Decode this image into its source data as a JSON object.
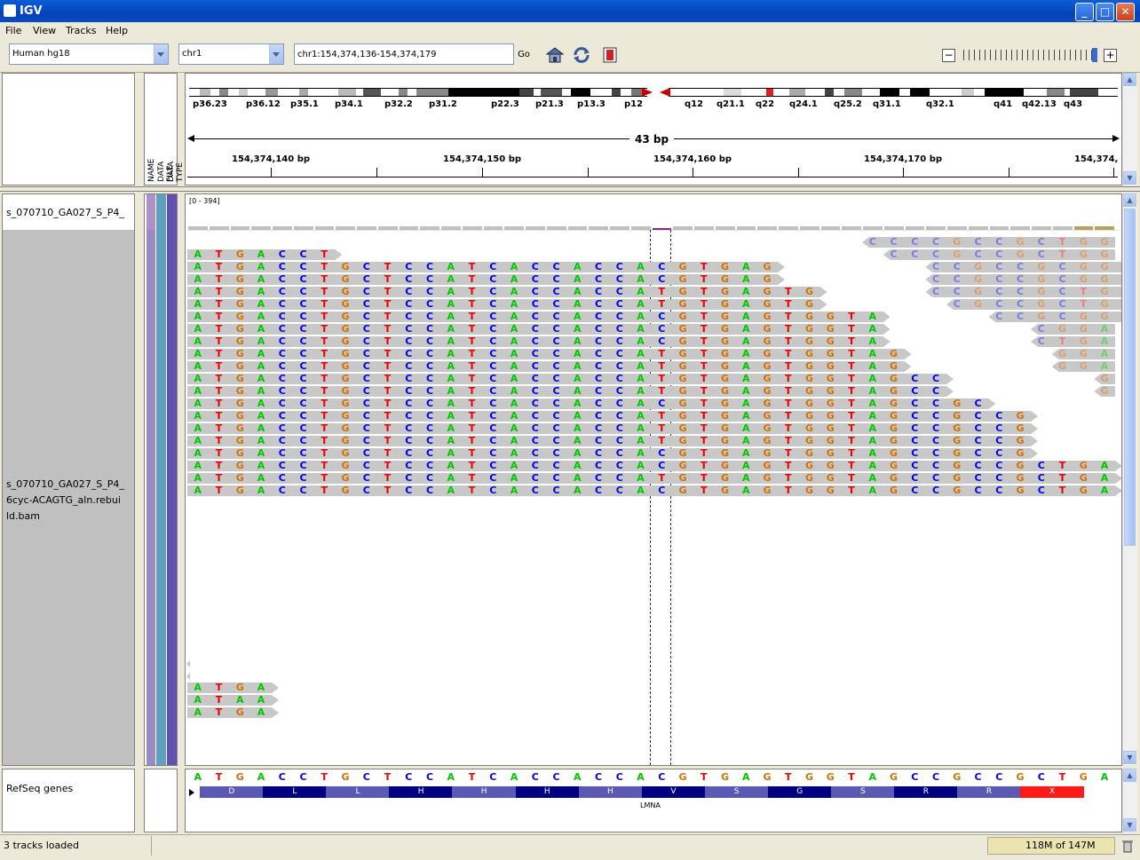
{
  "window": {
    "title": "IGV"
  },
  "menu": [
    "File",
    "View",
    "Tracks",
    "Help"
  ],
  "toolbar": {
    "genome": "Human hg18",
    "chromosome": "chr1",
    "locus": "chr1:154,374,136-154,374,179",
    "go_label": "Go",
    "icons": [
      "home-icon",
      "refresh-icon",
      "region-icon"
    ],
    "zoom_minus": "−",
    "zoom_plus": "+"
  },
  "ideogram": {
    "bands": [
      "p36.23",
      "p36.12",
      "p35.1",
      "p34.1",
      "p32.2",
      "p31.2",
      "p22.3",
      "p21.3",
      "p13.3",
      "p12",
      "q12",
      "q21.1",
      "q22",
      "q24.1",
      "q25.2",
      "q31.1",
      "q32.1",
      "q41",
      "q42.13",
      "q43"
    ],
    "span_label": "43 bp",
    "ruler": [
      "154,374,140 bp",
      "154,374,150 bp",
      "154,374,160 bp",
      "154,374,170 bp",
      "154,374,"
    ]
  },
  "attribute_headers": [
    "NAME",
    "DATA FILE",
    "DATA TYPE"
  ],
  "tracks": {
    "coverage_name": "s_070710_GA027_S_P4_",
    "alignment_name": "s_070710_GA027_S_P4_6cyc-ACAGTG_aln.rebuild.bam",
    "alignment_name_lines": [
      "s_070710_GA027_S_P4_",
      "6cyc-ACAGTG_aln.rebui",
      "ld.bam"
    ],
    "coverage_range": "[0 - 394]",
    "refseq_name": "RefSeq genes",
    "gene_name": "LMNA"
  },
  "reference_sequence": "ATGACCTGCTCCATCACCACCACGTGAGTGGTAGCCGCCGCTGA",
  "amino_acids": [
    "D",
    "L",
    "L",
    "H",
    "H",
    "H",
    "H",
    "V",
    "S",
    "G",
    "S",
    "R",
    "R",
    "X"
  ],
  "reads": [
    {
      "start": 32,
      "seq": "CCCCGCCGCTGG",
      "dim": true
    },
    {
      "start": 33,
      "seq": "CCCGCCGCTGG",
      "dim": true
    },
    {
      "start": 0,
      "seq": "ATGACCT"
    },
    {
      "start": 35,
      "seq": "CCGCCGCGGG",
      "dim": true
    },
    {
      "start": 0,
      "seq": "ATGACCTGCTCCATCACCACCACGTGAG"
    },
    {
      "start": 35,
      "seq": "CCGCCGCGGG",
      "dim": true
    },
    {
      "start": 0,
      "seq": "ATGACCTGCTCCATCACCACCACGTGAG"
    },
    {
      "start": 35,
      "seq": "CCGCCGCTGG",
      "dim": true
    },
    {
      "start": 0,
      "seq": "ATGACCTGCTCCATCACCACCATGTGAGTG"
    },
    {
      "start": 36,
      "seq": "CGCCGCTGG",
      "dim": true
    },
    {
      "start": 0,
      "seq": "ATGACCTGCTCCATCACCACCATGTGAGTG"
    },
    {
      "start": 38,
      "seq": "CCGCGGA",
      "dim": true
    },
    {
      "start": 0,
      "seq": "ATGACCTGCTCCATCACCACCACGTGAGTGGTA"
    },
    {
      "start": 40,
      "seq": "CGGA",
      "dim": true
    },
    {
      "start": 0,
      "seq": "ATGACCTGCTCCATCACCACCACGTGAGTGGTA"
    },
    {
      "start": 40,
      "seq": "CTGA",
      "dim": true
    },
    {
      "start": 0,
      "seq": "ATGACCTGCTCCATCACCACCACGTGAGTGGTA"
    },
    {
      "start": 41,
      "seq": "GGA",
      "dim": true
    },
    {
      "start": 0,
      "seq": "ATGACCTGCTCCATCACCACCATGTGAGTGGTAG"
    },
    {
      "start": 41,
      "seq": "GGA",
      "dim": true
    },
    {
      "start": 0,
      "seq": "ATGACCTGCTCCATCACCACCATGTGAGTGGTAG"
    },
    {
      "start": 43,
      "seq": "G",
      "dim": true
    },
    {
      "start": 0,
      "seq": "ATGACCTGCTCCATCACCACCATGTGAGTGGTAGCC"
    },
    {
      "start": 43,
      "seq": "G",
      "dim": true
    },
    {
      "start": 0,
      "seq": "ATGACCTGCTCCATCACCACCATGTGAGTGGTAGCC"
    },
    {
      "start": 0,
      "seq": "ATGACCTGCTCCATCACCACCACGTGAGTGGTAGCCGC"
    },
    {
      "start": 0,
      "seq": "ATGACCTGCTCCATCACCACCATGTGAGTGGTAGCCGCCG"
    },
    {
      "start": 0,
      "seq": "ATGACCTGCTCCATCACCACCATGTGAGTGGTAGCCGCCG"
    },
    {
      "start": 0,
      "seq": "ATGACCTGCTCCATCACCACCATGTGAGTGGTAGCCGCCG"
    },
    {
      "start": 0,
      "seq": "ATGACCTGCTCCATCACCACCACGTGAGTGGTAGCCGCCG"
    },
    {
      "start": 0,
      "seq": "ATGACCTGCTCCATCACCACCACGTGAGTGGTAGCCGCCGCTGA"
    },
    {
      "start": 0,
      "seq": "ATGACCTGCTCCATCACCACCATGTGAGTGGTAGCCGCCGCTGA"
    },
    {
      "start": 0,
      "seq": "ATGACCTGCTCCATCACCACCACGTGAGTGGTAGCCGCCGCTGA"
    }
  ],
  "lower_reads": [
    "ATGA",
    "ATAA",
    "ATGA"
  ],
  "status": {
    "message": "3 tracks loaded",
    "memory": "118M of 147M"
  },
  "colors": {
    "A": "#00c800",
    "C": "#0000e6",
    "G": "#d17105",
    "T": "#e60000",
    "aa_dark": "#000080",
    "aa_light": "#5a5ab4",
    "stop": "#ff1a1a"
  }
}
